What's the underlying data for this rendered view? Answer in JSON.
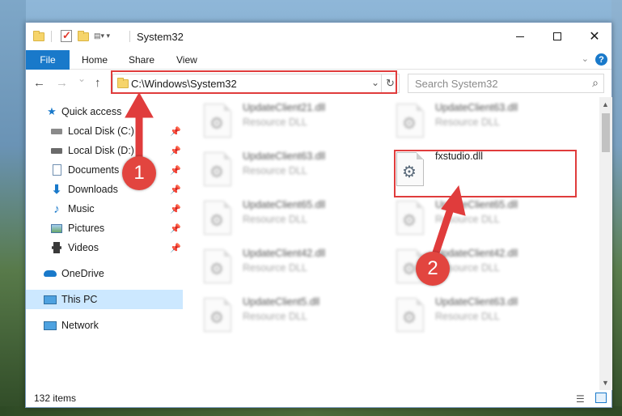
{
  "window": {
    "title": "System32",
    "controls": {
      "minimize": "",
      "maximize": "",
      "close": "✕"
    }
  },
  "ribbon": {
    "tabs": [
      "File",
      "Home",
      "Share",
      "View"
    ],
    "expand_icon": "chevron-down-icon",
    "help_label": "?"
  },
  "navigation": {
    "back": "←",
    "forward": "→",
    "recent": "⌄",
    "up": "↑",
    "address": "C:\\Windows\\System32",
    "address_dropdown": "⌄",
    "refresh": "↻",
    "search_placeholder": "Search System32",
    "search_icon": "⌕"
  },
  "sidebar": {
    "items": [
      {
        "label": "Quick access",
        "icon": "star-icon",
        "pinned": false
      },
      {
        "label": "Local Disk (C:)",
        "icon": "drive-icon",
        "pinned": true
      },
      {
        "label": "Local Disk (D:)",
        "icon": "drive-icon",
        "pinned": true
      },
      {
        "label": "Documents",
        "icon": "documents-icon",
        "pinned": true
      },
      {
        "label": "Downloads",
        "icon": "downloads-icon",
        "pinned": true
      },
      {
        "label": "Music",
        "icon": "music-icon",
        "pinned": true
      },
      {
        "label": "Pictures",
        "icon": "pictures-icon",
        "pinned": true
      },
      {
        "label": "Videos",
        "icon": "videos-icon",
        "pinned": true
      },
      {
        "label": "OneDrive",
        "icon": "onedrive-icon",
        "pinned": false
      },
      {
        "label": "This PC",
        "icon": "this-pc-icon",
        "pinned": false,
        "selected": true
      },
      {
        "label": "Network",
        "icon": "network-icon",
        "pinned": false
      }
    ]
  },
  "files": [
    {
      "name": "UpdateClient21.dll",
      "type": "Resource DLL",
      "blurred": true
    },
    {
      "name": "UpdateClient63.dll",
      "type": "Resource DLL",
      "blurred": true
    },
    {
      "name": "UpdateClient63.dll",
      "type": "Resource DLL",
      "blurred": true
    },
    {
      "name": "fxstudio.dll",
      "type": "",
      "blurred": false,
      "highlighted": true
    },
    {
      "name": "UpdateClient65.dll",
      "type": "Resource DLL",
      "blurred": true
    },
    {
      "name": "UpdateClient65.dll",
      "type": "Resource DLL",
      "blurred": true
    },
    {
      "name": "UpdateClient42.dll",
      "type": "Resource DLL",
      "blurred": true
    },
    {
      "name": "UpdateClient42.dll",
      "type": "Resource DLL",
      "blurred": true
    },
    {
      "name": "UpdateClient5.dll",
      "type": "Resource DLL",
      "blurred": true
    },
    {
      "name": "UpdateClient63.dll",
      "type": "Resource DLL",
      "blurred": true
    }
  ],
  "status": {
    "item_count": "132 items"
  },
  "annotations": {
    "step1": "1",
    "step2": "2",
    "color": "#e03c3c"
  },
  "colors": {
    "accent": "#1979ca",
    "selection": "#cce8ff"
  }
}
